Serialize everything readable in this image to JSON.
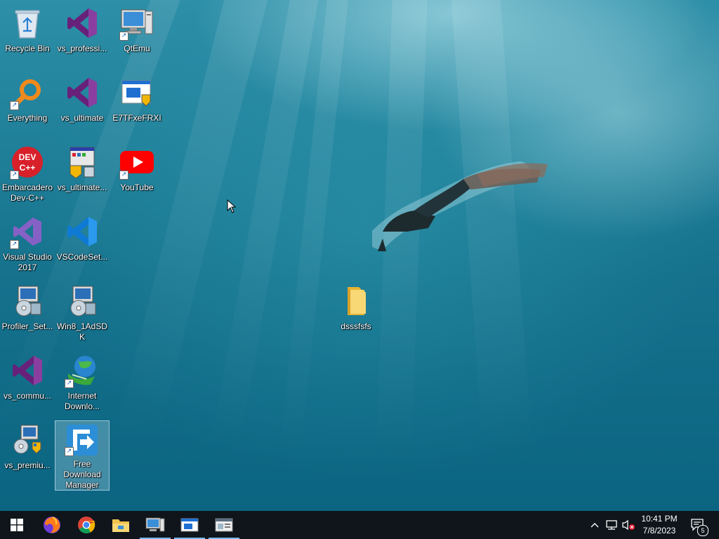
{
  "desktop": {
    "icons": [
      {
        "label": "Recycle Bin",
        "icon": "recycle-bin-icon"
      },
      {
        "label": "vs_professi...",
        "icon": "visual-studio-icon"
      },
      {
        "label": "QtEmu",
        "icon": "computer-icon"
      },
      {
        "label": "Everything",
        "icon": "search-magnifier-icon"
      },
      {
        "label": "vs_ultimate",
        "icon": "visual-studio-icon"
      },
      {
        "label": "E7TFxeFRXI",
        "icon": "installer-window-icon"
      },
      {
        "label": "Embarcadero Dev-C++",
        "icon": "dev-cpp-icon"
      },
      {
        "label": "vs_ultimate...",
        "icon": "installer-icon"
      },
      {
        "label": "YouTube",
        "icon": "youtube-icon"
      },
      {
        "label": "Visual Studio 2017",
        "icon": "visual-studio-2017-icon"
      },
      {
        "label": "VSCodeSet...",
        "icon": "vscode-icon"
      },
      {
        "label": "Profiler_Set...",
        "icon": "setup-disc-icon"
      },
      {
        "label": "Win8_1AdSDK",
        "icon": "setup-disc-icon"
      },
      {
        "label": "dsssfsfs",
        "icon": "folder-icon"
      },
      {
        "label": "vs_commu...",
        "icon": "visual-studio-icon"
      },
      {
        "label": "Internet Downlo...",
        "icon": "internet-download-manager-icon"
      },
      {
        "label": "vs_premiu...",
        "icon": "installer-icon"
      },
      {
        "label": "Free Download Manager",
        "icon": "free-download-manager-icon"
      }
    ]
  },
  "taskbar": {
    "start": {
      "icon": "windows-start-icon"
    },
    "pinned": [
      {
        "name": "Firefox",
        "icon": "firefox-icon"
      },
      {
        "name": "Chrome",
        "icon": "chrome-icon"
      },
      {
        "name": "File Explorer",
        "icon": "file-explorer-icon"
      },
      {
        "name": "QtEmu",
        "icon": "computer-icon"
      },
      {
        "name": "Window",
        "icon": "installer-window-icon"
      },
      {
        "name": "Window",
        "icon": "app-window-icon"
      }
    ],
    "tray": {
      "chevron_icon": "chevron-up-icon",
      "network_icon": "network-icon",
      "volume_icon": "volume-muted-icon",
      "time": "10:41 PM",
      "date": "7/8/2023",
      "notification_count": "5"
    }
  },
  "colors": {
    "taskbar": "#0f151b",
    "accent": "#76b9ed",
    "water": "#1f7f99"
  }
}
